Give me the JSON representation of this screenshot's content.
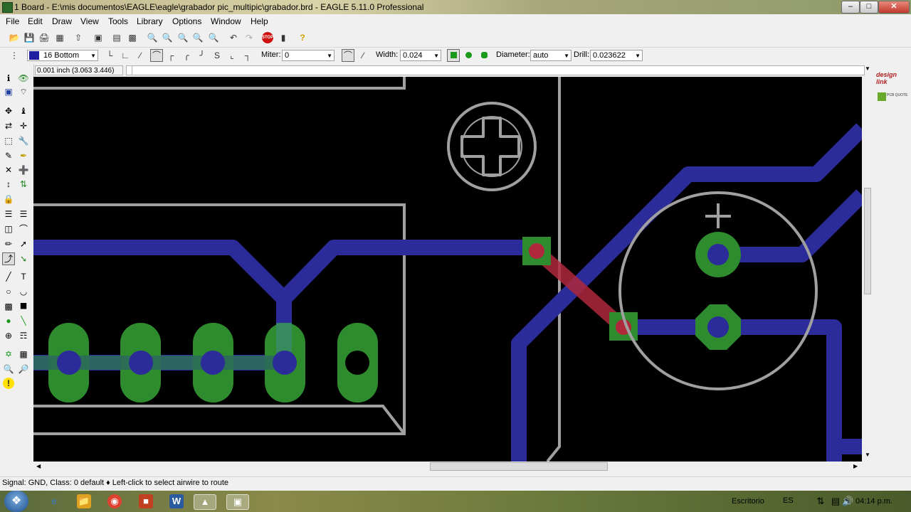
{
  "window": {
    "title": "1 Board - E:\\mis documentos\\EAGLE\\eagle\\grabador pic_multipic\\grabador.brd - EAGLE 5.11.0 Professional"
  },
  "menu": [
    "File",
    "Edit",
    "Draw",
    "View",
    "Tools",
    "Library",
    "Options",
    "Window",
    "Help"
  ],
  "toolbar2": {
    "layer": "16 Bottom",
    "layer_color": "#1f1fa0",
    "miter_label": "Miter:",
    "miter_value": "0",
    "width_label": "Width:",
    "width_value": "0.024",
    "diameter_label": "Diameter:",
    "diameter_value": "auto",
    "drill_label": "Drill:",
    "drill_value": "0.023622"
  },
  "command": {
    "coordinates": "0.001 inch (3.063 3.446)",
    "input_value": ""
  },
  "status": {
    "text": "Signal: GND, Class: 0 default  ♦ Left-click to select airwire to route"
  },
  "right_panel": {
    "logo_text": "design link",
    "pcb_quote": "PCB QUOTE"
  },
  "taskbar": {
    "lang": "ES",
    "desktop": "Escritorio",
    "clock": "04:14 p.m."
  },
  "colors": {
    "trace": "#2b2b9a",
    "pad": "#2e8b2e",
    "airwire_red": "#b0283c",
    "outline": "#a0a0a0"
  }
}
